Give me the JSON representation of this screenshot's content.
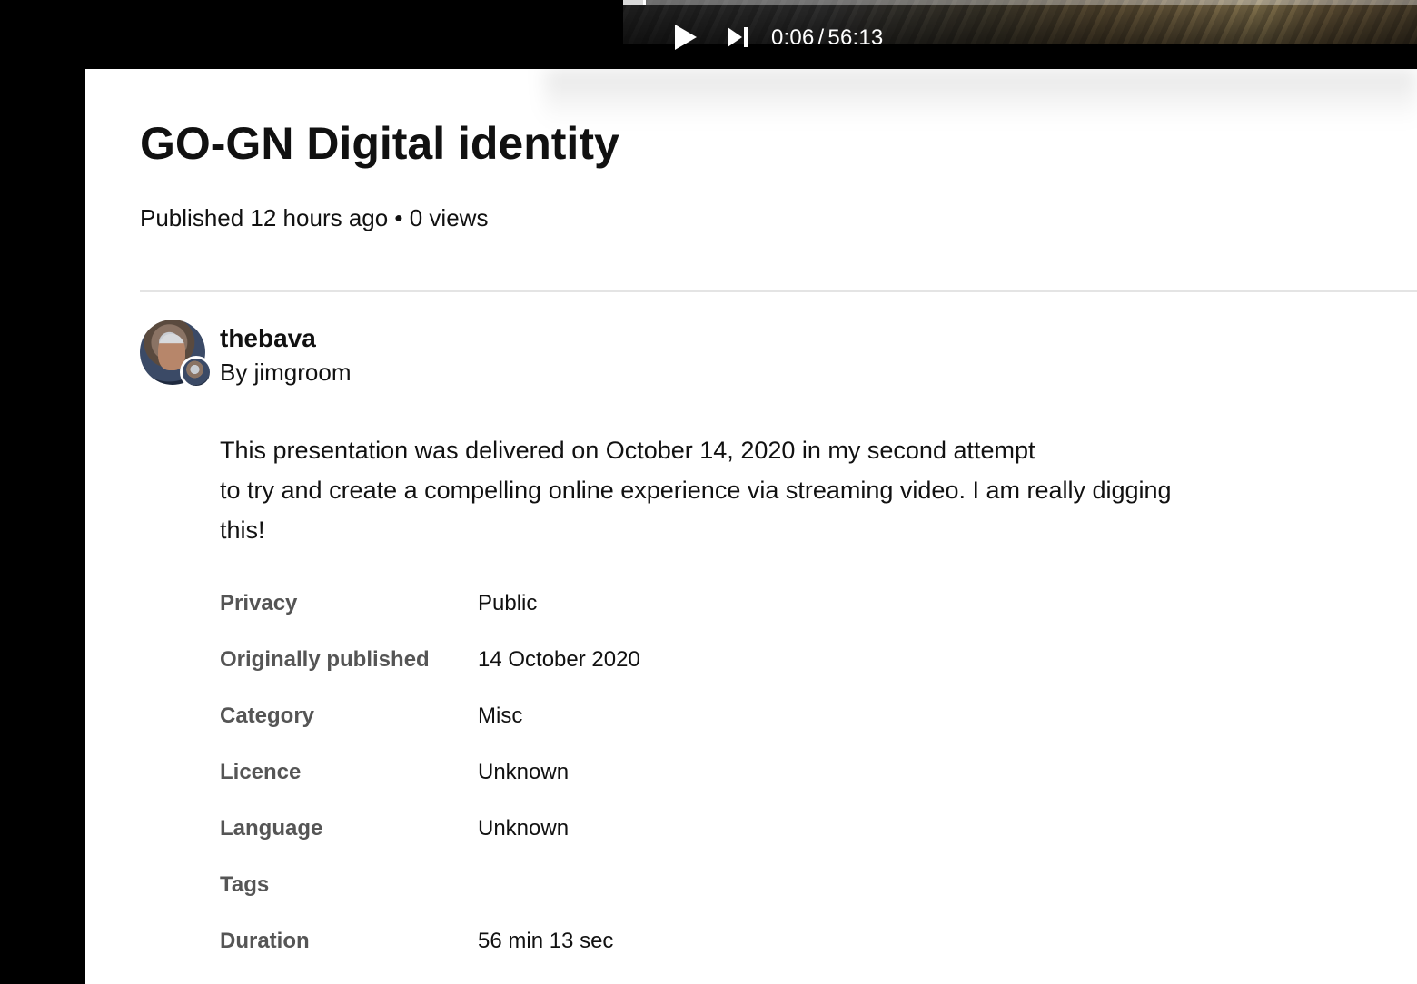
{
  "player": {
    "current_time": "0:06",
    "separator": "/",
    "duration": "56:13",
    "progress_fraction": 0.002,
    "play_icon": "play-icon",
    "next_icon": "skip-next-icon"
  },
  "video": {
    "title": "GO-GN Digital identity",
    "meta": "Published 12 hours ago • 0 views"
  },
  "channel": {
    "name": "thebava",
    "by_line": "By jimgroom",
    "avatar_icon": "avatar",
    "owner_avatar_icon": "owner-avatar"
  },
  "description": {
    "line1": "This presentation was delivered on October 14, 2020 in my second attempt",
    "line2": "to try and create a compelling online experience via streaming video. I am really digging this!"
  },
  "details": [
    {
      "label": "Privacy",
      "value": "Public"
    },
    {
      "label": "Originally published",
      "value": "14 October 2020"
    },
    {
      "label": "Category",
      "value": "Misc"
    },
    {
      "label": "Licence",
      "value": "Unknown"
    },
    {
      "label": "Language",
      "value": "Unknown"
    },
    {
      "label": "Tags",
      "value": ""
    },
    {
      "label": "Duration",
      "value": "56 min 13 sec"
    }
  ],
  "colors": {
    "background": "#000000",
    "card": "#ffffff",
    "text": "#111111",
    "label": "#555555",
    "divider": "#e4e4e4"
  }
}
